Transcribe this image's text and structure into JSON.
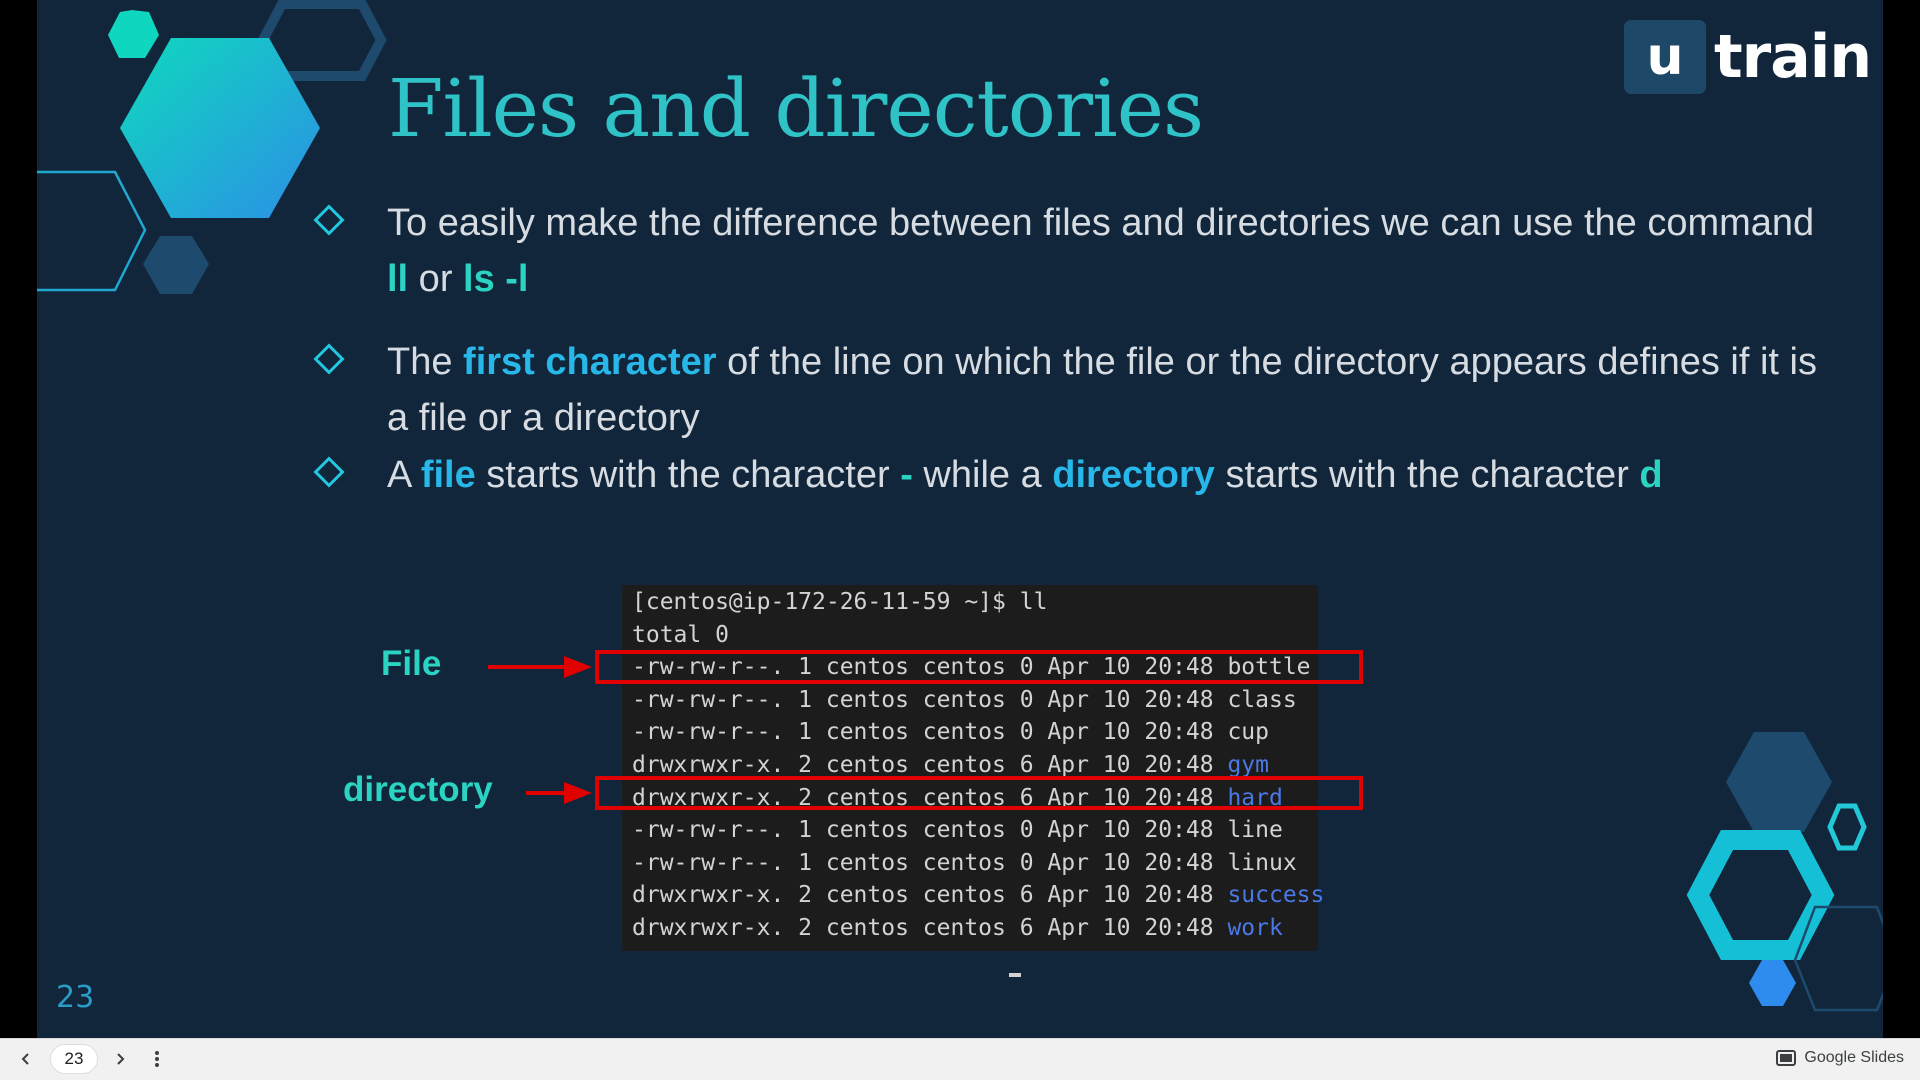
{
  "slide": {
    "title": "Files and directories",
    "slide_number": "23",
    "logo": {
      "mark": "u",
      "text": "train"
    },
    "bullets": [
      {
        "segments": [
          {
            "text": "To easily make the difference between files and directories we can use the command ",
            "style": "normal"
          },
          {
            "text": "ll",
            "style": "hl"
          },
          {
            "text": " or ",
            "style": "normal"
          },
          {
            "text": "ls -l",
            "style": "hl"
          }
        ]
      },
      {
        "segments": [
          {
            "text": "The ",
            "style": "normal"
          },
          {
            "text": "first character",
            "style": "hl2"
          },
          {
            "text": " of the line on which the file or the directory appears defines if it is a file or a directory",
            "style": "normal"
          }
        ]
      },
      {
        "segments": [
          {
            "text": "A ",
            "style": "normal"
          },
          {
            "text": "file",
            "style": "hl2"
          },
          {
            "text": " starts with the character ",
            "style": "normal"
          },
          {
            "text": "-",
            "style": "hl"
          },
          {
            "text": " while a ",
            "style": "normal"
          },
          {
            "text": "directory",
            "style": "hl2"
          },
          {
            "text": " starts with the character ",
            "style": "normal"
          },
          {
            "text": "d",
            "style": "hl"
          }
        ]
      }
    ],
    "terminal": {
      "prompt": "[centos@ip-172-26-11-59 ~]$ ll",
      "total": "total 0",
      "rows": [
        {
          "meta": "-rw-rw-r--. 1 centos centos 0 Apr 10 20:48 ",
          "name": "bottle",
          "is_dir": false
        },
        {
          "meta": "-rw-rw-r--. 1 centos centos 0 Apr 10 20:48 ",
          "name": "class",
          "is_dir": false
        },
        {
          "meta": "-rw-rw-r--. 1 centos centos 0 Apr 10 20:48 ",
          "name": "cup",
          "is_dir": false
        },
        {
          "meta": "drwxrwxr-x. 2 centos centos 6 Apr 10 20:48 ",
          "name": "gym",
          "is_dir": true
        },
        {
          "meta": "drwxrwxr-x. 2 centos centos 6 Apr 10 20:48 ",
          "name": "hard",
          "is_dir": true
        },
        {
          "meta": "-rw-rw-r--. 1 centos centos 0 Apr 10 20:48 ",
          "name": "line",
          "is_dir": false
        },
        {
          "meta": "-rw-rw-r--. 1 centos centos 0 Apr 10 20:48 ",
          "name": "linux",
          "is_dir": false
        },
        {
          "meta": "drwxrwxr-x. 2 centos centos 6 Apr 10 20:48 ",
          "name": "success",
          "is_dir": true
        },
        {
          "meta": "drwxrwxr-x. 2 centos centos 6 Apr 10 20:48 ",
          "name": "work",
          "is_dir": true
        }
      ]
    },
    "annotations": {
      "file_label": "File",
      "directory_label": "directory"
    }
  },
  "bottom_bar": {
    "page_number": "23",
    "brand": "Google Slides",
    "icons": {
      "prev": "chevron-left-icon",
      "next": "chevron-right-icon",
      "more": "more-vertical-icon",
      "brand": "slides-icon"
    }
  },
  "colors": {
    "background": "#11263a",
    "title": "#2fc3c8",
    "highlight": "#2bd4c2",
    "highlight_blue": "#27b7e8",
    "dir_name": "#4a78e6",
    "annotation_box": "#e00000"
  }
}
